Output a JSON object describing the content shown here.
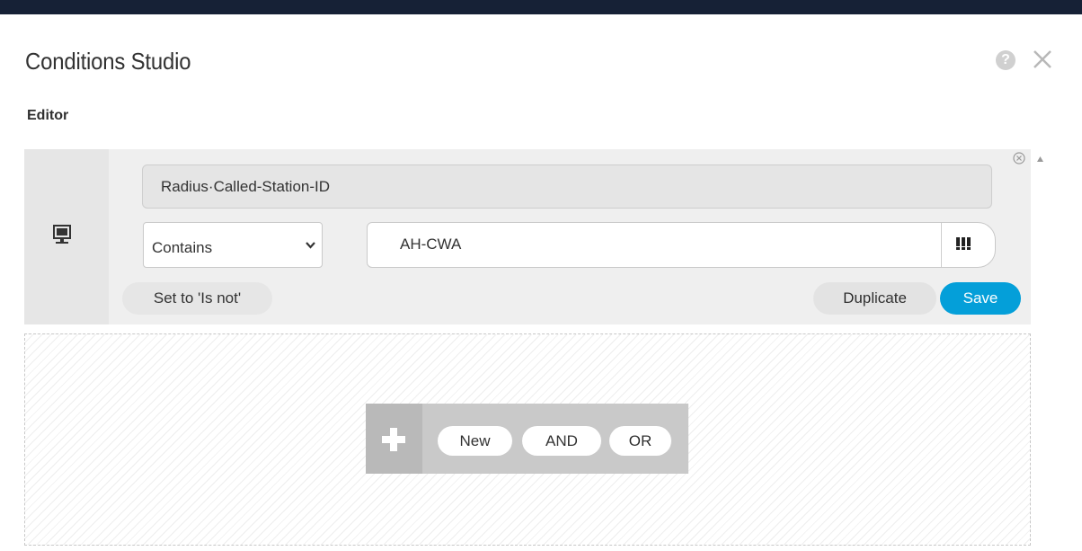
{
  "header": {
    "title": "Conditions Studio",
    "help_icon": "help-icon",
    "close_icon": "close-icon"
  },
  "editor": {
    "section_label": "Editor",
    "condition": {
      "device_icon": "network-device-icon",
      "attribute": "Radius·Called-Station-ID",
      "operator": "Contains",
      "value": "AH-CWA",
      "set_not_label": "Set to 'Is not'",
      "duplicate_label": "Duplicate",
      "save_label": "Save"
    },
    "add_bar": {
      "plus_icon": "plus-icon",
      "new_label": "New",
      "and_label": "AND",
      "or_label": "OR"
    }
  },
  "colors": {
    "topbar": "#162136",
    "accent": "#049fd9",
    "panel": "#efefef"
  }
}
